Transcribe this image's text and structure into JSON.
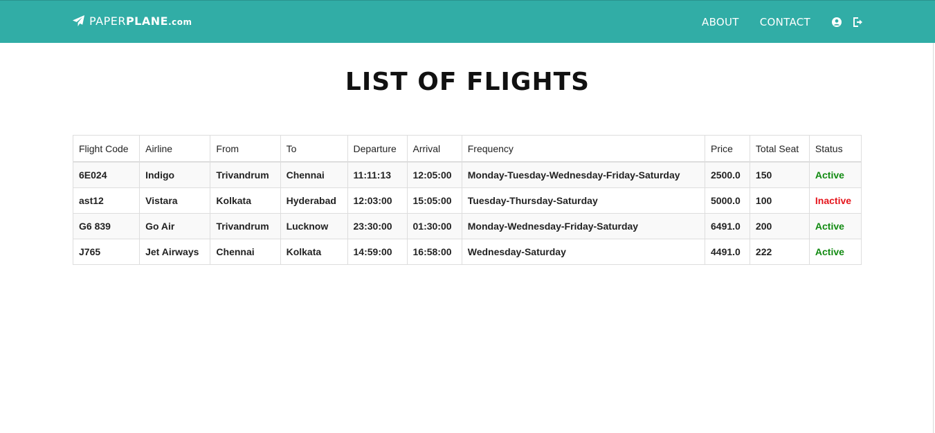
{
  "navbar": {
    "brand": {
      "light": "PAPER",
      "bold": "PLANE",
      "suffix": ".com"
    },
    "links": [
      "ABOUT",
      "CONTACT"
    ],
    "icons": [
      "user-icon",
      "logout-icon"
    ],
    "color": "#31ada6"
  },
  "page": {
    "title": "LIST OF FLIGHTS"
  },
  "table": {
    "headers": [
      "Flight Code",
      "Airline",
      "From",
      "To",
      "Departure",
      "Arrival",
      "Frequency",
      "Price",
      "Total Seat",
      "Status"
    ],
    "rows": [
      {
        "code": "6E024",
        "airline": "Indigo",
        "from": "Trivandrum",
        "to": "Chennai",
        "departure": "11:11:13",
        "arrival": "12:05:00",
        "frequency": "Monday-Tuesday-Wednesday-Friday-Saturday",
        "price": "2500.0",
        "seats": "150",
        "status": "Active"
      },
      {
        "code": "ast12",
        "airline": "Vistara",
        "from": "Kolkata",
        "to": "Hyderabad",
        "departure": "12:03:00",
        "arrival": "15:05:00",
        "frequency": "Tuesday-Thursday-Saturday",
        "price": "5000.0",
        "seats": "100",
        "status": "Inactive"
      },
      {
        "code": "G6 839",
        "airline": "Go Air",
        "from": "Trivandrum",
        "to": "Lucknow",
        "departure": "23:30:00",
        "arrival": "01:30:00",
        "frequency": "Monday-Wednesday-Friday-Saturday",
        "price": "6491.0",
        "seats": "200",
        "status": "Active"
      },
      {
        "code": "J765",
        "airline": "Jet Airways",
        "from": "Chennai",
        "to": "Kolkata",
        "departure": "14:59:00",
        "arrival": "16:58:00",
        "frequency": "Wednesday-Saturday",
        "price": "4491.0",
        "seats": "222",
        "status": "Active"
      }
    ],
    "status_colors": {
      "Active": "#118a11",
      "Inactive": "#e5141b"
    }
  }
}
